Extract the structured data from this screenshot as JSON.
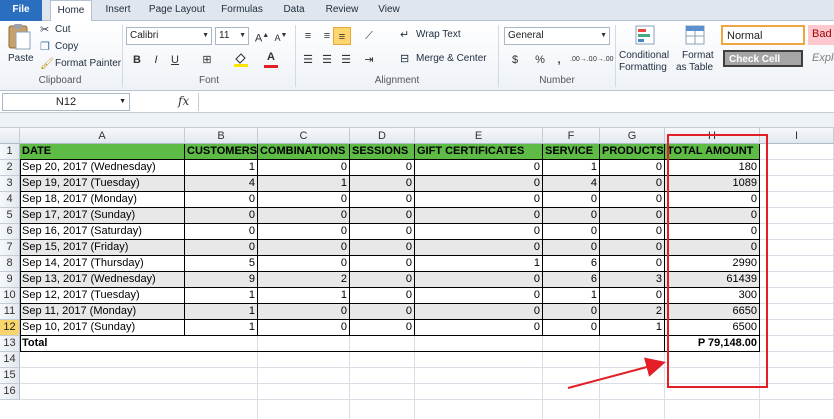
{
  "ribbon_tabs": [
    "File",
    "Home",
    "Insert",
    "Page Layout",
    "Formulas",
    "Data",
    "Review",
    "View"
  ],
  "clipboard": {
    "paste": "Paste",
    "cut": "Cut",
    "copy": "Copy",
    "format_painter": "Format Painter",
    "label": "Clipboard"
  },
  "font": {
    "name": "Calibri",
    "size": "11",
    "label": "Font",
    "bold": "B",
    "italic": "I",
    "underline": "U"
  },
  "alignment": {
    "wrap_text": "Wrap Text",
    "merge_center": "Merge & Center",
    "label": "Alignment"
  },
  "number": {
    "format": "General",
    "label": "Number",
    "currency": "$",
    "percent": "%",
    "comma": ",",
    "inc_decimal": ".00→.0",
    "dec_decimal": ".0→.00"
  },
  "styles": {
    "conditional_1": "Conditional",
    "conditional_2": "Formatting",
    "format_table_1": "Format",
    "format_table_2": "as Table",
    "normal": "Normal",
    "bad": "Bad",
    "check_cell": "Check Cell",
    "explanatory": "Explo"
  },
  "formula_bar": {
    "name_box": "N12",
    "fx": "fx",
    "content": ""
  },
  "columns": [
    "A",
    "B",
    "C",
    "D",
    "E",
    "F",
    "G",
    "H",
    "I"
  ],
  "rows": [
    "1",
    "2",
    "3",
    "4",
    "5",
    "6",
    "7",
    "8",
    "9",
    "10",
    "11",
    "12",
    "13",
    "14",
    "15",
    "16"
  ],
  "headers": [
    "DATE",
    "CUSTOMERS",
    "COMBINATIONS",
    "SESSIONS",
    "GIFT CERTIFICATES",
    "SERVICE",
    "PRODUCTS",
    "TOTAL AMOUNT"
  ],
  "table": [
    [
      "Sep 20, 2017 (Wednesday)",
      "1",
      "0",
      "0",
      "0",
      "1",
      "0",
      "180"
    ],
    [
      "Sep 19, 2017 (Tuesday)",
      "4",
      "1",
      "0",
      "0",
      "4",
      "0",
      "1089"
    ],
    [
      "Sep 18, 2017 (Monday)",
      "0",
      "0",
      "0",
      "0",
      "0",
      "0",
      "0"
    ],
    [
      "Sep 17, 2017 (Sunday)",
      "0",
      "0",
      "0",
      "0",
      "0",
      "0",
      "0"
    ],
    [
      "Sep 16, 2017 (Saturday)",
      "0",
      "0",
      "0",
      "0",
      "0",
      "0",
      "0"
    ],
    [
      "Sep 15, 2017 (Friday)",
      "0",
      "0",
      "0",
      "0",
      "0",
      "0",
      "0"
    ],
    [
      "Sep 14, 2017 (Thursday)",
      "5",
      "0",
      "0",
      "1",
      "6",
      "0",
      "2990"
    ],
    [
      "Sep 13, 2017 (Wednesday)",
      "9",
      "2",
      "0",
      "0",
      "6",
      "3",
      "61439"
    ],
    [
      "Sep 12, 2017 (Tuesday)",
      "1",
      "1",
      "0",
      "0",
      "1",
      "0",
      "300"
    ],
    [
      "Sep 11, 2017 (Monday)",
      "1",
      "0",
      "0",
      "0",
      "0",
      "2",
      "6650"
    ],
    [
      "Sep 10, 2017 (Sunday)",
      "1",
      "0",
      "0",
      "0",
      "0",
      "1",
      "6500"
    ]
  ],
  "total": {
    "label": "Total",
    "value": "P 79,148.00"
  },
  "colors": {
    "header_green": "#5dbb46",
    "highlight_red": "#e41e26",
    "selected_row": "#f9d56c",
    "band_gray": "#e8e8e8"
  },
  "icons": [
    "cut-icon",
    "copy-icon",
    "format-painter-icon",
    "paste-icon",
    "grow-font-icon",
    "shrink-font-icon",
    "fill-color-icon",
    "font-color-icon",
    "borders-icon",
    "conditional-formatting-icon",
    "format-as-table-icon",
    "fx-icon"
  ]
}
